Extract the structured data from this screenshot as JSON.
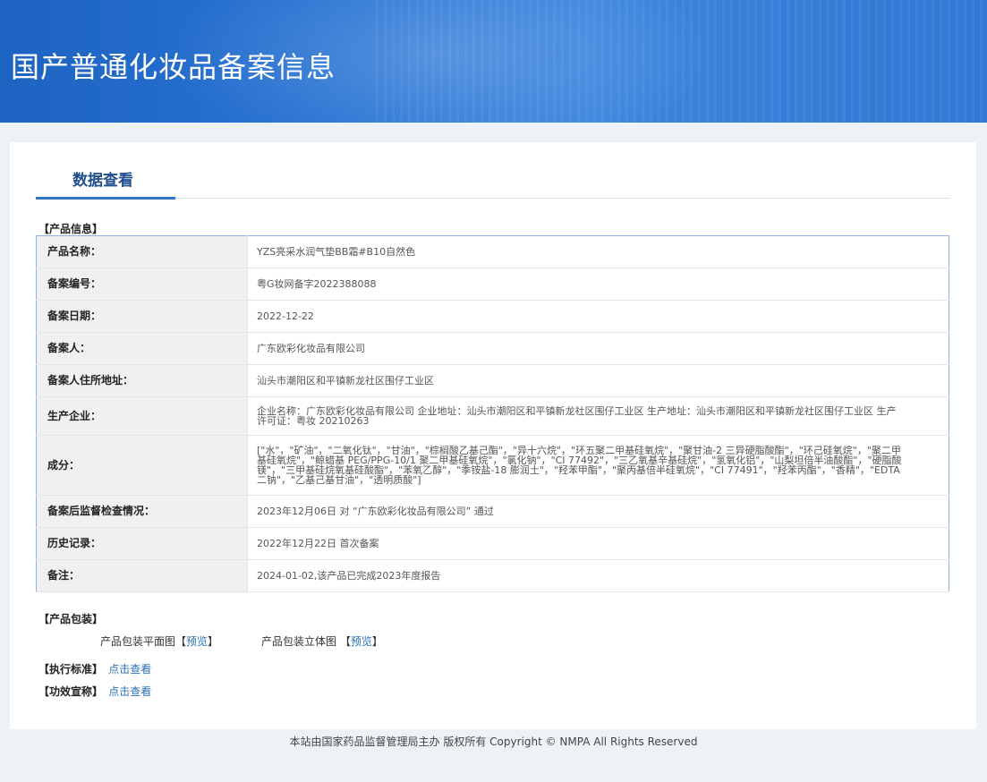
{
  "banner": {
    "title": "国产普通化妆品备案信息"
  },
  "tab": {
    "title": "数据查看"
  },
  "sections": {
    "product_info": "【产品信息】",
    "packaging": "【产品包装】",
    "standard": "【执行标准】",
    "efficacy": "【功效宣称】"
  },
  "table": {
    "rows": [
      {
        "label": "产品名称：",
        "value": "YZS亮采水润气垫BB霜#B10自然色"
      },
      {
        "label": "备案编号：",
        "value": "粤G妆网备字2022388088"
      },
      {
        "label": "备案日期：",
        "value": "2022-12-22"
      },
      {
        "label": "备案人：",
        "value": "广东欧彩化妆品有限公司"
      },
      {
        "label": "备案人住所地址：",
        "value": "汕头市潮阳区和平镇新龙社区围仔工业区"
      },
      {
        "label": "生产企业：",
        "value": "企业名称：广东欧彩化妆品有限公司 企业地址：汕头市潮阳区和平镇新龙社区围仔工业区 生产地址：汕头市潮阳区和平镇新龙社区围仔工业区 生产许可证：粤妆 20210263"
      },
      {
        "label": "成分：",
        "value": "[\"水\"，\"矿油\"，\"二氧化钛\"，\"甘油\"，\"棕榈酸乙基己酯\"，\"异十六烷\"，\"环五聚二甲基硅氧烷\"，\"聚甘油-2 三异硬脂酸酯\"，\"环己硅氧烷\"，\"聚二甲基硅氧烷\"，\"鲸蜡基 PEG/PPG-10/1 聚二甲基硅氧烷\"，\"氯化钠\"，\"CI 77492\"，\"三乙氧基辛基硅烷\"，\"氢氧化铝\"，\"山梨坦倍半油酸酯\"，\"硬脂酸镁\"，\"三甲基硅烷氧基硅酸酯\"，\"苯氧乙醇\"，\"季铵盐-18 膨润土\"，\"羟苯甲酯\"，\"聚丙基倍半硅氧烷\"，\"CI 77491\"，\"羟苯丙酯\"，\"香精\"，\"EDTA 二钠\"，\"乙基己基甘油\"，\"透明质酸\"]"
      },
      {
        "label": "备案后监督检查情况：",
        "value": "2023年12月06日 对 “广东欧彩化妆品有限公司” 通过"
      },
      {
        "label": "历史记录：",
        "value": "2022年12月22日 首次备案"
      },
      {
        "label": "备注：",
        "value": "2024-01-02,该产品已完成2023年度报告"
      }
    ]
  },
  "packaging": {
    "flat_label": "产品包装平面图",
    "flat_link": "预览",
    "stereo_label": "产品包装立体图",
    "stereo_link": "预览",
    "bracket_open": "【",
    "bracket_close": "】"
  },
  "links": {
    "standard": "点击查看",
    "efficacy": "点击查看"
  },
  "footer": {
    "text": "本站由国家药品监督管理局主办 版权所有 Copyright © NMPA All Rights Reserved"
  }
}
